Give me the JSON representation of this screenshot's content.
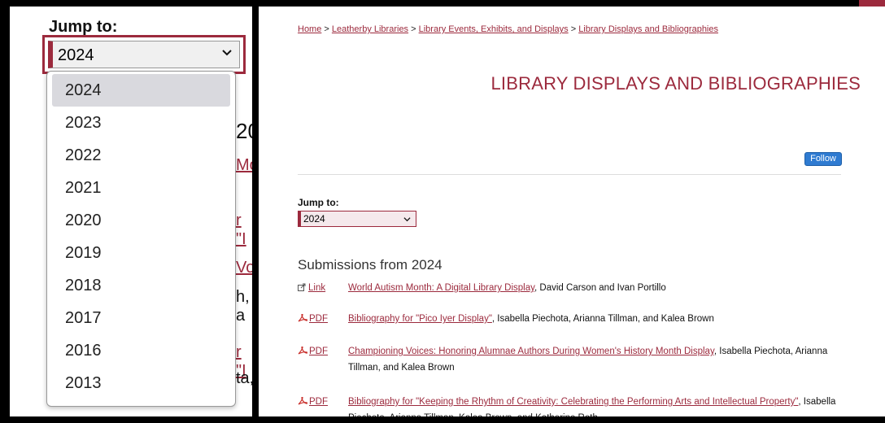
{
  "zoom_panel": {
    "jump_label": "Jump to:",
    "selected_value": "2024",
    "options": [
      "2024",
      "2023",
      "2022",
      "2021",
      "2020",
      "2019",
      "2018",
      "2017",
      "2016",
      "2013"
    ],
    "bg_fragments": [
      "20",
      "Mo",
      "r \"I",
      "Voi",
      "h, a",
      "r \"I",
      "ta,"
    ]
  },
  "page": {
    "breadcrumb": {
      "items": [
        "Home",
        "Leatherby Libraries",
        "Library Events, Exhibits, and Displays",
        "Library Displays and Bibliographies"
      ],
      "separator": " > "
    },
    "title": "LIBRARY DISPLAYS AND BIBLIOGRAPHIES",
    "follow_label": "Follow",
    "jump_label": "Jump to:",
    "jump_value": "2024",
    "submissions_heading": "Submissions from 2024",
    "entries": [
      {
        "type": "Link",
        "title": "World Autism Month: A Digital Library Display",
        "authors": ", David Carson and Ivan Portillo"
      },
      {
        "type": "PDF",
        "title": "Bibliography for \"Pico Iyer Display\"",
        "authors": ", Isabella Piechota, Arianna Tillman, and Kalea Brown"
      },
      {
        "type": "PDF",
        "title": "Championing Voices: Honoring Alumnae Authors During Women's History Month Display",
        "authors": ", Isabella Piechota, Arianna Tillman, and Kalea Brown"
      },
      {
        "type": "PDF",
        "title": "Bibliography for \"Keeping the Rhythm of Creativity: Celebrating the Performing Arts and Intellectual Property\"",
        "authors": ", Isabella Piechota, Arianna Tillman, Kalea Brown, and Katherine Roth"
      }
    ]
  },
  "colors": {
    "accent": "#9c2a3d",
    "follow": "#2f7bd1"
  },
  "icons": {
    "pdf": "pdf-icon",
    "link": "external-link-icon",
    "chevron": "chevron-down-icon"
  }
}
